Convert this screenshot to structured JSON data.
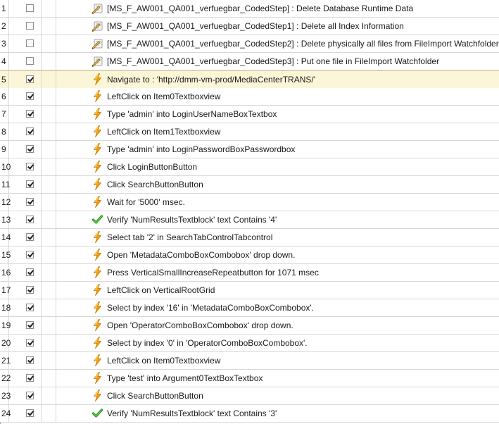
{
  "rows": [
    {
      "num": "1",
      "checked": false,
      "icon": "coded-step-icon",
      "text": "[MS_F_AW001_QA001_verfuegbar_CodedStep] : Delete Database Runtime Data"
    },
    {
      "num": "2",
      "checked": false,
      "icon": "coded-step-icon",
      "text": "[MS_F_AW001_QA001_verfuegbar_CodedStep1] : Delete all Index Information"
    },
    {
      "num": "3",
      "checked": false,
      "icon": "coded-step-icon",
      "text": "[MS_F_AW001_QA001_verfuegbar_CodedStep2] : Delete physically all files from FileImport Watchfolder"
    },
    {
      "num": "4",
      "checked": false,
      "icon": "coded-step-icon",
      "text": "[MS_F_AW001_QA001_verfuegbar_CodedStep3] : Put one file in FileImport Watchfolder"
    },
    {
      "num": "5",
      "checked": true,
      "icon": "lightning-icon",
      "text": "Navigate to : 'http://dmm-vm-prod/MediaCenterTRANS/'",
      "selected": true
    },
    {
      "num": "6",
      "checked": true,
      "icon": "lightning-icon",
      "text": "LeftClick on Item0Textboxview"
    },
    {
      "num": "7",
      "checked": true,
      "icon": "lightning-icon",
      "text": "Type 'admin' into LoginUserNameBoxTextbox"
    },
    {
      "num": "8",
      "checked": true,
      "icon": "lightning-icon",
      "text": "LeftClick on Item1Textboxview"
    },
    {
      "num": "9",
      "checked": true,
      "icon": "lightning-icon",
      "text": "Type 'admin' into LoginPasswordBoxPasswordbox"
    },
    {
      "num": "10",
      "checked": true,
      "icon": "lightning-icon",
      "text": "Click LoginButtonButton"
    },
    {
      "num": "11",
      "checked": true,
      "icon": "lightning-icon",
      "text": "Click SearchButtonButton"
    },
    {
      "num": "12",
      "checked": true,
      "icon": "lightning-icon",
      "text": "Wait for '5000' msec."
    },
    {
      "num": "13",
      "checked": true,
      "icon": "checkmark-icon",
      "text": "Verify 'NumResultsTextblock' text Contains '4'"
    },
    {
      "num": "14",
      "checked": true,
      "icon": "lightning-icon",
      "text": "Select tab '2' in SearchTabControlTabcontrol"
    },
    {
      "num": "15",
      "checked": true,
      "icon": "lightning-icon",
      "text": "Open 'MetadataComboBoxCombobox' drop down."
    },
    {
      "num": "16",
      "checked": true,
      "icon": "lightning-icon",
      "text": "Press VerticalSmallIncreaseRepeatbutton for 1071 msec"
    },
    {
      "num": "17",
      "checked": true,
      "icon": "lightning-icon",
      "text": "LeftClick on VerticalRootGrid"
    },
    {
      "num": "18",
      "checked": true,
      "icon": "lightning-icon",
      "text": "Select by index '16' in 'MetadataComboBoxCombobox'."
    },
    {
      "num": "19",
      "checked": true,
      "icon": "lightning-icon",
      "text": "Open 'OperatorComboBoxCombobox' drop down."
    },
    {
      "num": "20",
      "checked": true,
      "icon": "lightning-icon",
      "text": "Select by index '0' in 'OperatorComboBoxCombobox'."
    },
    {
      "num": "21",
      "checked": true,
      "icon": "lightning-icon",
      "text": "LeftClick on Item0Textboxview"
    },
    {
      "num": "22",
      "checked": true,
      "icon": "lightning-icon",
      "text": "Type 'test' into Argument0TextBoxTextbox"
    },
    {
      "num": "23",
      "checked": true,
      "icon": "lightning-icon",
      "text": "Click SearchButtonButton"
    },
    {
      "num": "24",
      "checked": true,
      "icon": "checkmark-icon",
      "text": "Verify 'NumResultsTextblock' text Contains '3'"
    }
  ],
  "colors": {
    "selected_row": "#fbf6d8",
    "lightning": "#f5a300",
    "checkmark": "#2aa52a"
  }
}
